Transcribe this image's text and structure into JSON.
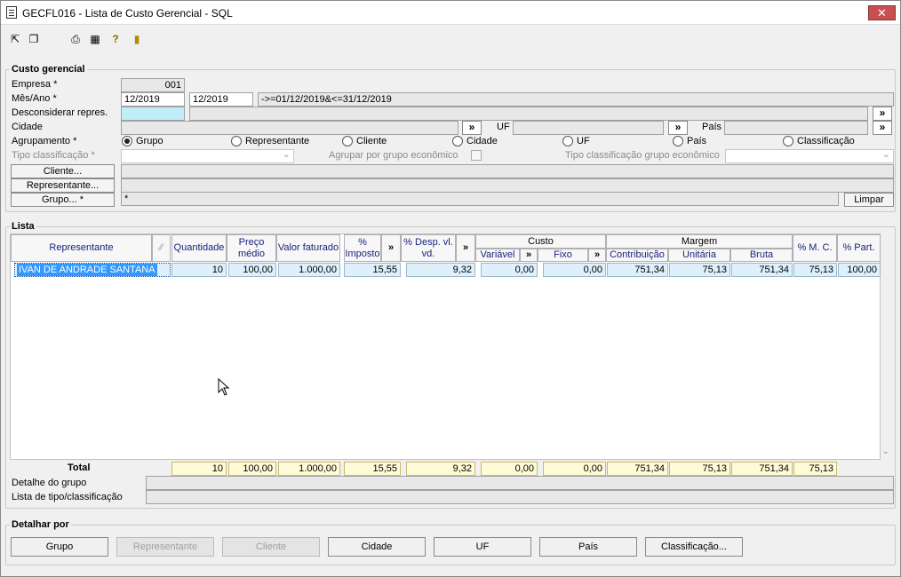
{
  "window": {
    "title": "GECFL016 - Lista de Custo Gerencial - SQL",
    "close_label": "✕"
  },
  "toolbar": {
    "icons": [
      "export-icon",
      "copy-icon",
      "print-icon",
      "calendar-icon",
      "help-icon",
      "exit-icon"
    ]
  },
  "custo": {
    "section_title": "Custo gerencial",
    "empresa_label": "Empresa *",
    "empresa_value": "001",
    "mesano_label": "Mês/Ano *",
    "mes_ini": "12/2019",
    "mes_fim": "12/2019",
    "mes_range": "->=01/12/2019&<=31/12/2019",
    "desconsiderar_label": "Desconsiderar repres.",
    "cidade_label": "Cidade",
    "uf_label": "UF",
    "pais_label": "País",
    "more_label": "»",
    "agrupamento_label": "Agrupamento *",
    "radios": [
      "Grupo",
      "Representante",
      "Cliente",
      "Cidade",
      "UF",
      "País",
      "Classificação"
    ],
    "tipo_class_label": "Tipo classificação *",
    "agrupar_label": "Agrupar por grupo econômico",
    "tipo_class_ge_label": "Tipo classificação grupo econômico",
    "cliente_btn": "Cliente...",
    "representante_btn": "Representante...",
    "grupo_btn": "Grupo... *",
    "grupo_value": "*",
    "limpar_btn": "Limpar"
  },
  "lista": {
    "section_title": "Lista",
    "headers": {
      "representante": "Representante",
      "sort": "⁄⁄",
      "quantidade": "Quantidade",
      "preco": "Preço médio",
      "valor": "Valor faturado",
      "imposto": "% Imposto",
      "more": "»",
      "despesa": "% Desp. vl. vd.",
      "custo": "Custo",
      "variavel": "Variável",
      "fixo": "Fixo",
      "margem": "Margem",
      "contribuicao": "Contribuição",
      "unitaria": "Unitária",
      "bruta": "Bruta",
      "mc": "% M. C.",
      "part": "% Part."
    },
    "row": {
      "representante": "IVAN DE ANDRADE SANTANA",
      "quantidade": "10",
      "preco": "100,00",
      "valor": "1.000,00",
      "imposto": "15,55",
      "despesa": "9,32",
      "variavel": "0,00",
      "fixo": "0,00",
      "contribuicao": "751,34",
      "unitaria": "75,13",
      "bruta": "751,34",
      "mc": "75,13",
      "part": "100,00"
    },
    "total_label": "Total",
    "total": {
      "quantidade": "10",
      "preco": "100,00",
      "valor": "1.000,00",
      "imposto": "15,55",
      "despesa": "9,32",
      "variavel": "0,00",
      "fixo": "0,00",
      "contribuicao": "751,34",
      "unitaria": "75,13",
      "bruta": "751,34",
      "mc": "75,13"
    },
    "detalhe_grupo_label": "Detalhe do grupo",
    "lista_tipo_label": "Lista de tipo/classificação"
  },
  "detalhar": {
    "section_title": "Detalhar por",
    "buttons": [
      "Grupo",
      "Representante",
      "Cliente",
      "Cidade",
      "UF",
      "País",
      "Classificação..."
    ]
  },
  "colors": {
    "selection": "#3399ff",
    "row_fill": "#ddf0fb",
    "total_fill": "#fffbd6",
    "header_text": "#1a237e"
  }
}
